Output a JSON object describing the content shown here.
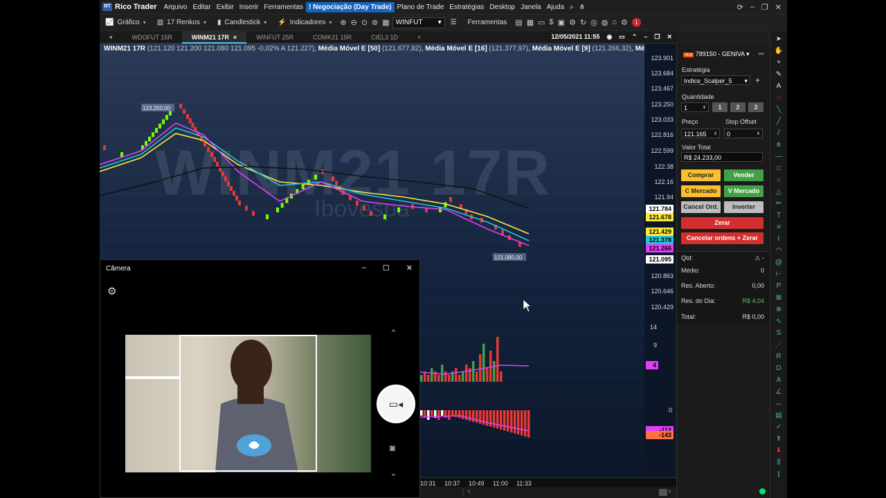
{
  "app": {
    "brand": "Rico Trader",
    "menu": [
      "Arquivo",
      "Editar",
      "Exibir",
      "Inserir",
      "Ferramentas",
      "Negociação (Day Trade)",
      "Plano de Trade",
      "Estratégias",
      "Desktop",
      "Janela",
      "Ajuda"
    ],
    "active_menu": "Negociação (Day Trade)"
  },
  "toolbar": {
    "grafico": "Gráfico",
    "renkos": "17 Renkos",
    "candlestick": "Candlestick",
    "indicadores": "Indicadores",
    "symbol": "WINFUT",
    "ferramentas": "Ferramentas",
    "notif_count": "1"
  },
  "tabs": {
    "items": [
      "WDOFUT 15R",
      "WINM21 17R",
      "WINFUT 25R",
      "COMK21 15R",
      "CIEL3 1D"
    ],
    "active": "WINM21 17R",
    "datetime": "12/05/2021 11:55"
  },
  "chart_info": {
    "symbol": "WINM21 17R",
    "ohlc": "(121.120  121.200  121.080  121.095  -0,02%  A 121.227)",
    "ma1": "Média Móvel E [50]",
    "ma1_val": "(121.677,82)",
    "ma2": "Média Móvel E [16]",
    "ma2_val": "(121.377,97)",
    "ma3": "Média Móvel E [9]",
    "ma3_val": "(121.266,32)",
    "ma4": "Médi",
    "watermark": "WINM21 17R",
    "watermark2": "Ibovespa",
    "high_label": "123.250,00",
    "low_label": "121.080,00"
  },
  "y_ticks": [
    "123.901",
    "123.684",
    "123.467",
    "123.250",
    "123.033",
    "122.816",
    "122.599",
    "122.38",
    "122.16",
    "121.94",
    "120.863",
    "120.646",
    "120.429"
  ],
  "price_tags": [
    {
      "v": "121.784",
      "bg": "#ffffff",
      "fg": "#000"
    },
    {
      "v": "121.678",
      "bg": "#ffeb3b",
      "fg": "#000"
    },
    {
      "v": "121.429",
      "bg": "#ffeb3b",
      "fg": "#000"
    },
    {
      "v": "121.378",
      "bg": "#26c6da",
      "fg": "#000"
    },
    {
      "v": "121.266",
      "bg": "#e040fb",
      "fg": "#000"
    },
    {
      "v": "121.095",
      "bg": "#ffffff",
      "fg": "#000"
    }
  ],
  "vol_ticks": [
    "14",
    "9",
    "4"
  ],
  "hist_ticks": [
    "0",
    "-112",
    "-143"
  ],
  "time_labels": [
    "10:31",
    "10:37",
    "10:49",
    "11:00",
    "11:33"
  ],
  "panel": {
    "account": "789150 - GENIVA",
    "estrategia_label": "Estratégia",
    "estrategia": "Indice_Scalper_5",
    "quantidade_label": "Quantidade",
    "quantidade": "1",
    "qty_buttons": [
      "1",
      "2",
      "3"
    ],
    "preco_label": "Preço",
    "preco": "121.165",
    "stop_label": "Stop Offset",
    "stop": "0",
    "valor_label": "Valor Total",
    "valor": "R$ 24.233,00",
    "comprar": "Comprar",
    "vender": "Vender",
    "c_mercado": "C Mercado",
    "v_mercado": "V Mercado",
    "cancel_ord": "Cancel Ord.",
    "inverter": "Inverter",
    "zerar": "Zerar",
    "cancelar_zerar": "Cancelar ordens + Zerar",
    "qtd_label": "Qtd:",
    "qtd_val": "-",
    "medio_label": "Médio:",
    "medio_val": "0",
    "res_aberto_label": "Res. Aberto:",
    "res_aberto_val": "0,00",
    "res_dia_label": "Res. do Dia:",
    "res_dia_val": "R$ 4,04",
    "total_label": "Total:",
    "total_val": "R$ 0,00"
  },
  "camera": {
    "title": "Câmera"
  }
}
